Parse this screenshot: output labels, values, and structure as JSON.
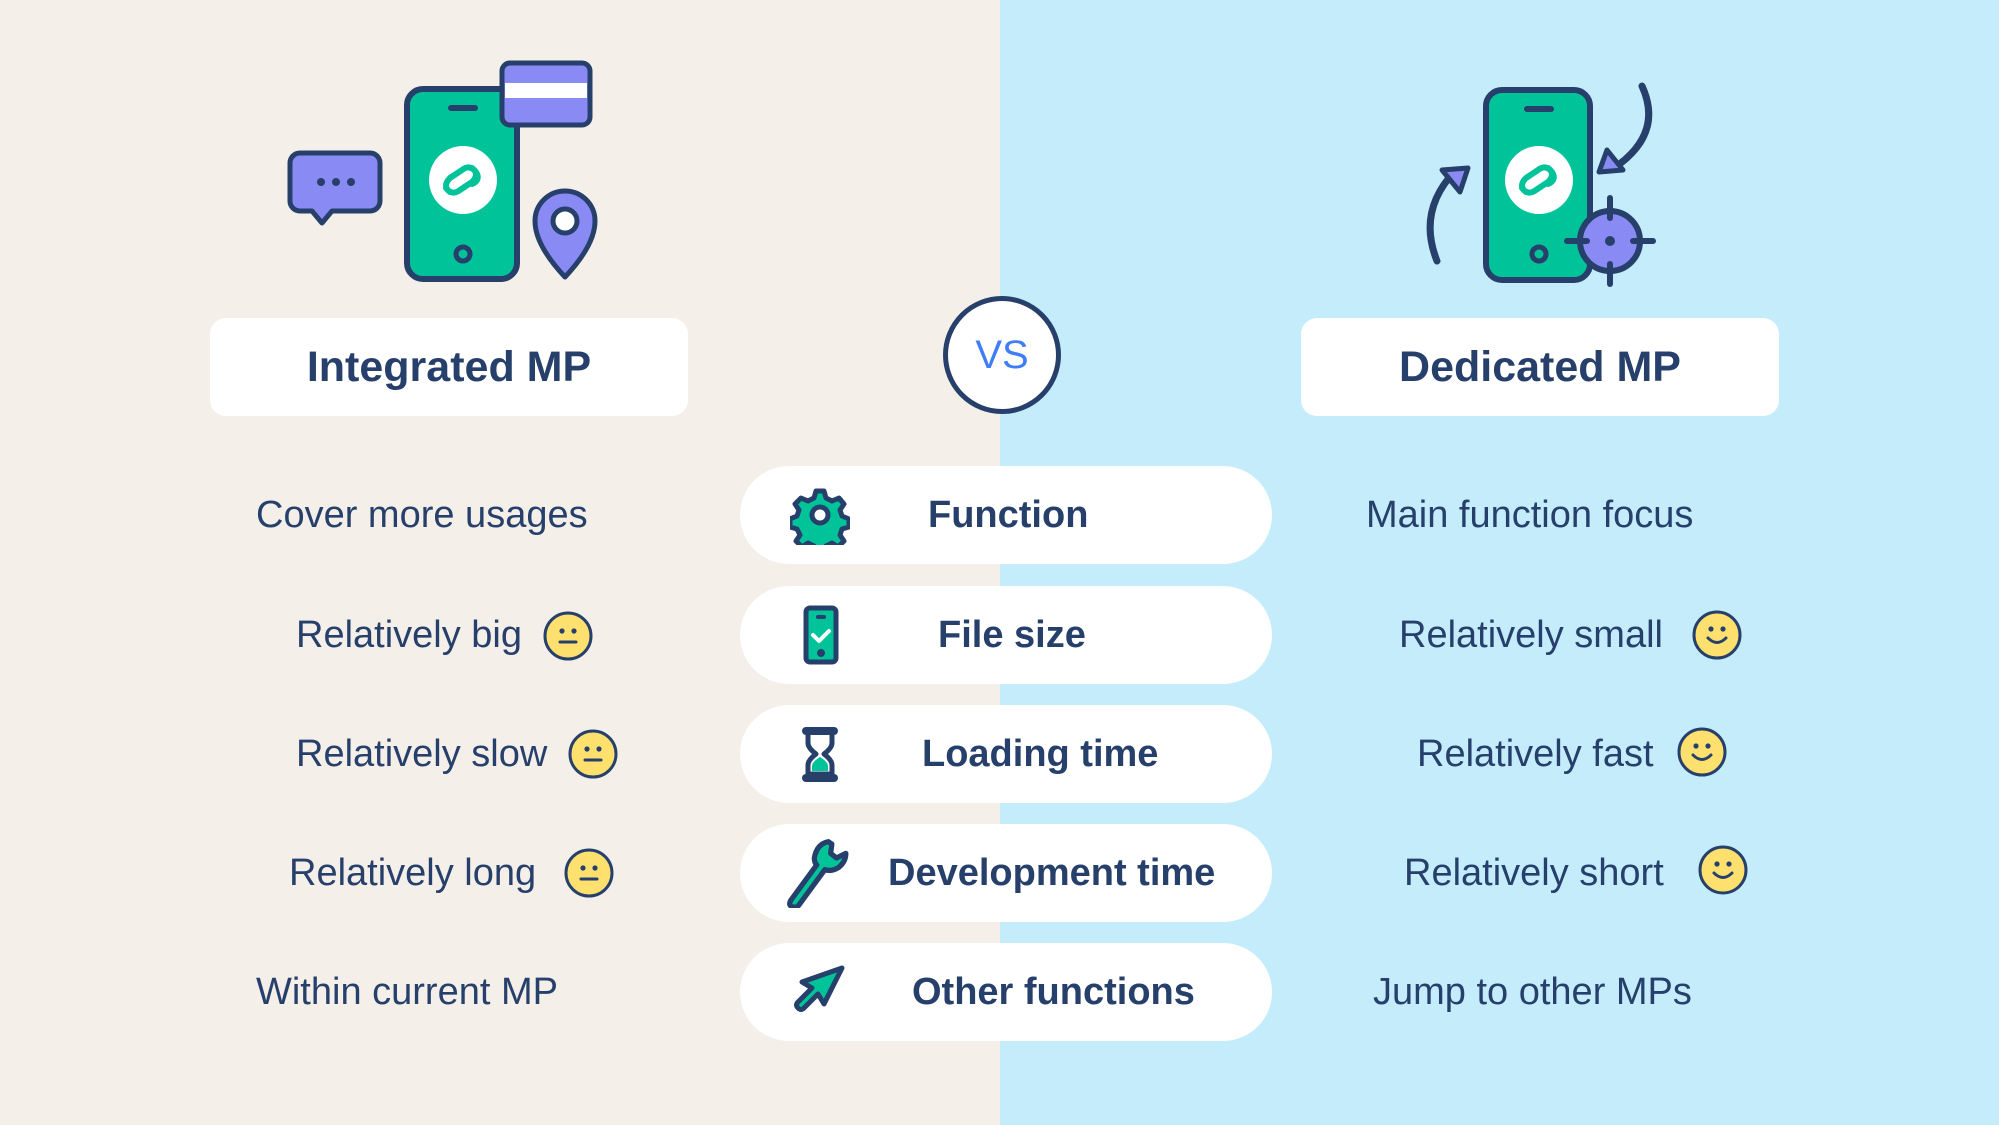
{
  "colors": {
    "left_bg": "#f4efe8",
    "right_bg": "#c4ecfb",
    "navy": "#27406b",
    "green": "#00c39a",
    "purple": "#8a8af5",
    "vs_blue": "#3f7ef5",
    "face_yellow": "#fde06e"
  },
  "left": {
    "title": "Integrated MP",
    "hero_icon": "phone-with-chat-card-location-icon",
    "items": [
      {
        "text": "Cover more usages",
        "face": null
      },
      {
        "text": "Relatively big",
        "face": "neutral-face-icon"
      },
      {
        "text": "Relatively slow",
        "face": "neutral-face-icon"
      },
      {
        "text": "Relatively long",
        "face": "neutral-face-icon"
      },
      {
        "text": "Within current MP",
        "face": null
      }
    ]
  },
  "vs_label": "VS",
  "criteria": [
    {
      "label": "Function",
      "icon": "gear-icon"
    },
    {
      "label": "File size",
      "icon": "phone-check-icon"
    },
    {
      "label": "Loading time",
      "icon": "hourglass-icon"
    },
    {
      "label": "Development time",
      "icon": "wrench-icon"
    },
    {
      "label": "Other functions",
      "icon": "arrow-cursor-icon"
    }
  ],
  "right": {
    "title": "Dedicated MP",
    "hero_icon": "phone-with-arrows-target-icon",
    "items": [
      {
        "text": "Main function focus",
        "face": null
      },
      {
        "text": "Relatively small",
        "face": "smile-face-icon"
      },
      {
        "text": "Relatively fast",
        "face": "smile-face-icon"
      },
      {
        "text": "Relatively short",
        "face": "smile-face-icon"
      },
      {
        "text": "Jump to other MPs",
        "face": null
      }
    ]
  }
}
